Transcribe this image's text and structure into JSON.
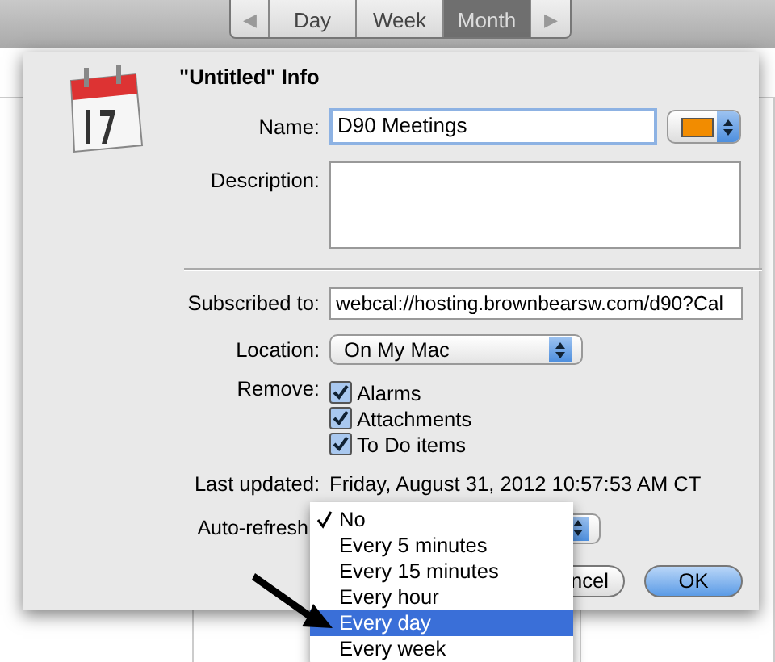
{
  "toolbar": {
    "segments": [
      {
        "label": "◀",
        "selected": false
      },
      {
        "label": "Day",
        "selected": false
      },
      {
        "label": "Week",
        "selected": false
      },
      {
        "label": "Month",
        "selected": true
      },
      {
        "label": "▶",
        "selected": false
      }
    ]
  },
  "sheet": {
    "title": "\"Untitled\" Info",
    "name": {
      "label": "Name:",
      "value": "D90 Meetings",
      "color": "#f28c00"
    },
    "description": {
      "label": "Description:"
    },
    "subscribed": {
      "label": "Subscribed to:",
      "value": "webcal://hosting.brownbearsw.com/d90?Cal"
    },
    "location": {
      "label": "Location:",
      "value": "On My Mac"
    },
    "remove": {
      "label": "Remove:",
      "options": [
        {
          "label": "Alarms",
          "checked": true
        },
        {
          "label": "Attachments",
          "checked": true
        },
        {
          "label": "To Do items",
          "checked": true
        }
      ]
    },
    "last_updated": {
      "label": "Last updated:",
      "value": "Friday, August 31, 2012 10:57:53 AM CT"
    },
    "auto_refresh": {
      "label": "Auto-refresh"
    },
    "buttons": [
      {
        "label": "ncel",
        "default": false
      },
      {
        "label": "OK",
        "default": true
      }
    ]
  },
  "menu": {
    "items": [
      {
        "label": "No",
        "checked": true,
        "selected": false
      },
      {
        "label": "Every 5 minutes",
        "checked": false,
        "selected": false
      },
      {
        "label": "Every 15 minutes",
        "checked": false,
        "selected": false
      },
      {
        "label": "Every hour",
        "checked": false,
        "selected": false
      },
      {
        "label": "Every day",
        "checked": false,
        "selected": true
      },
      {
        "label": "Every week",
        "checked": false,
        "selected": false
      }
    ]
  }
}
